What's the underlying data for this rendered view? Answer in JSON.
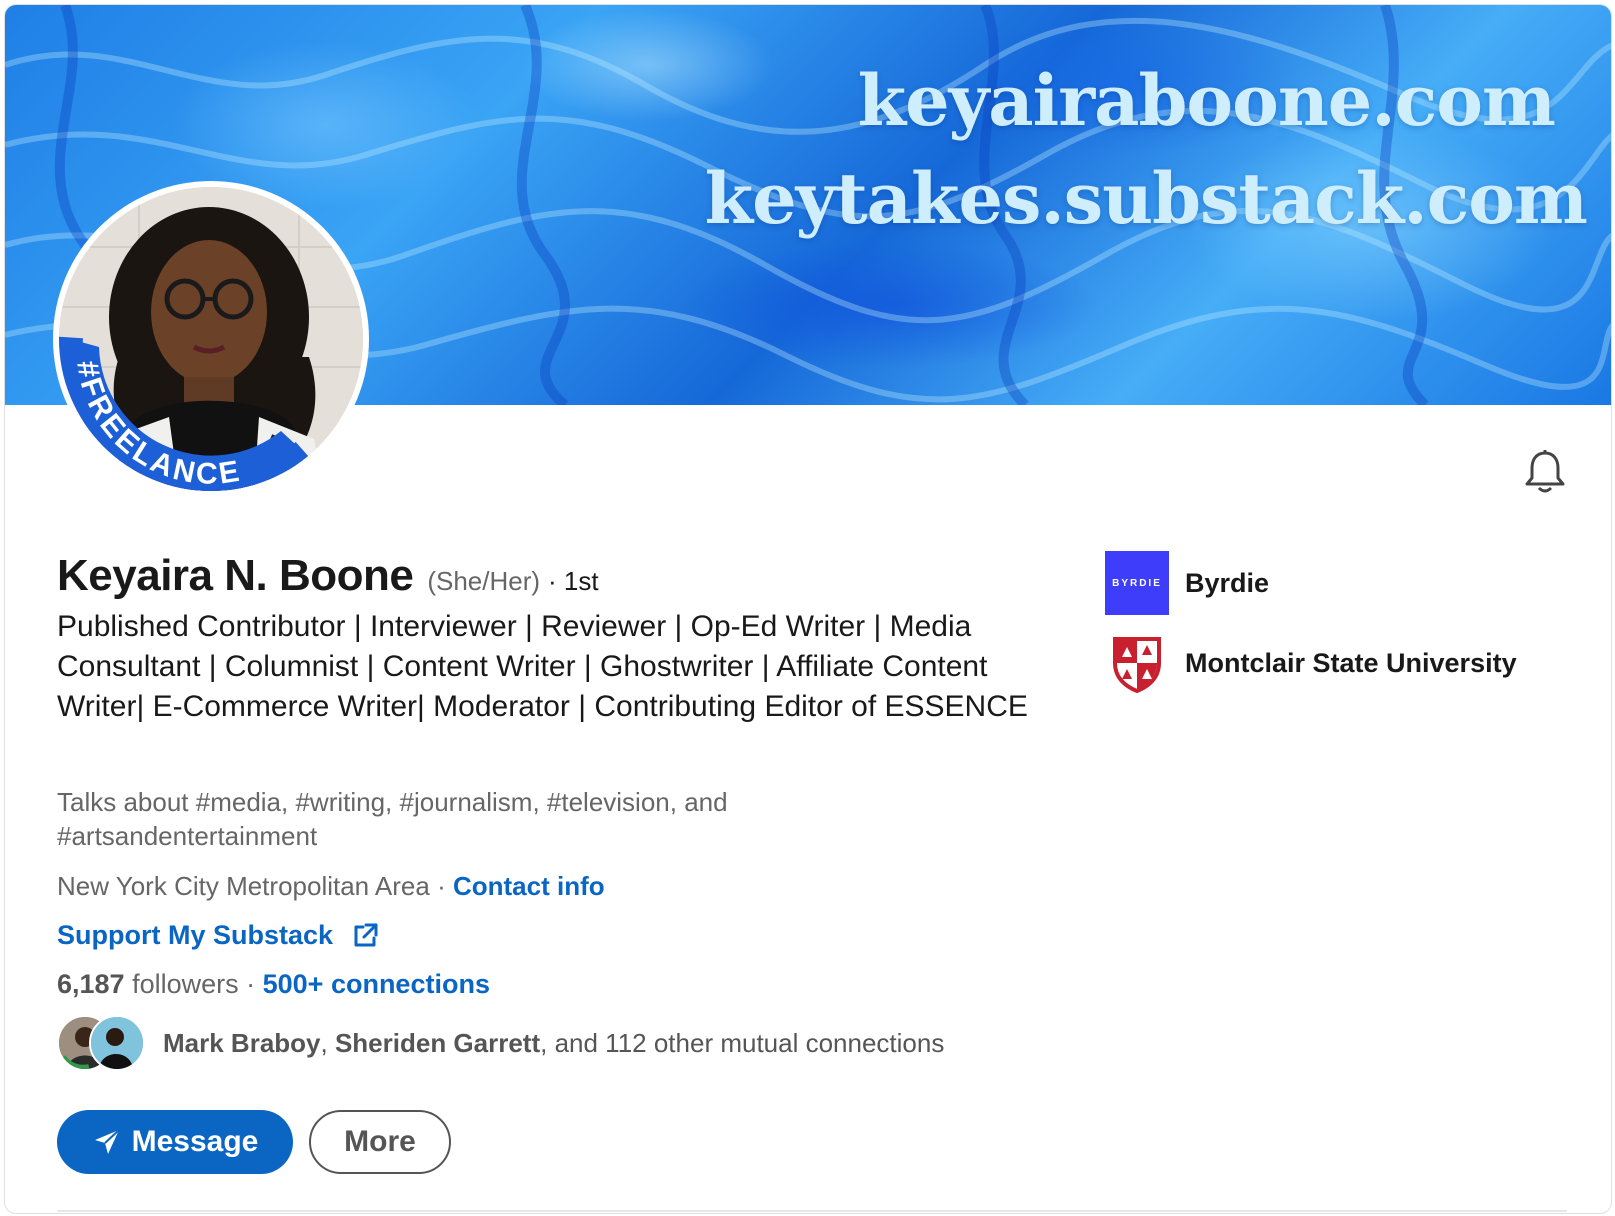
{
  "banner": {
    "line1": "keyairaboone.com",
    "line2": "keytakes.substack.com"
  },
  "avatar": {
    "badge_text": "#FREELANCE"
  },
  "profile": {
    "name": "Keyaira N. Boone",
    "pronouns": "(She/Her)",
    "degree": "· 1st",
    "headline": "Published Contributor | Interviewer | Reviewer | Op-Ed Writer | Media Consultant | Columnist | Content Writer | Ghostwriter | Affiliate Content Writer| E-Commerce Writer| Moderator | Contributing Editor of ESSENCE",
    "talks_about": "Talks about #media, #writing, #journalism, #television, and #artsandentertainment",
    "location": "New York City Metropolitan Area",
    "location_sep": " · ",
    "contact_info_label": "Contact info",
    "website_label": "Support My Substack",
    "followers_count": "6,187",
    "followers_label": " followers",
    "connections_sep": "  · ",
    "connections_label": "500+ connections",
    "mutual": {
      "name1": "Mark Braboy",
      "sep": ", ",
      "name2": "Sheriden Garrett",
      "rest": ", and 112 other mutual connections"
    }
  },
  "actions": {
    "message_label": "Message",
    "more_label": "More"
  },
  "orgs": [
    {
      "name": "Byrdie",
      "logo_text": "BYRDIE",
      "logo_color": "#3d3dfa"
    },
    {
      "name": "Montclair State University",
      "logo_color": "#c8202f"
    }
  ],
  "colors": {
    "accent": "#0a66c2",
    "banner": "#2b8ff0"
  },
  "icons": [
    "bell-icon",
    "external-link-icon",
    "send-icon"
  ]
}
